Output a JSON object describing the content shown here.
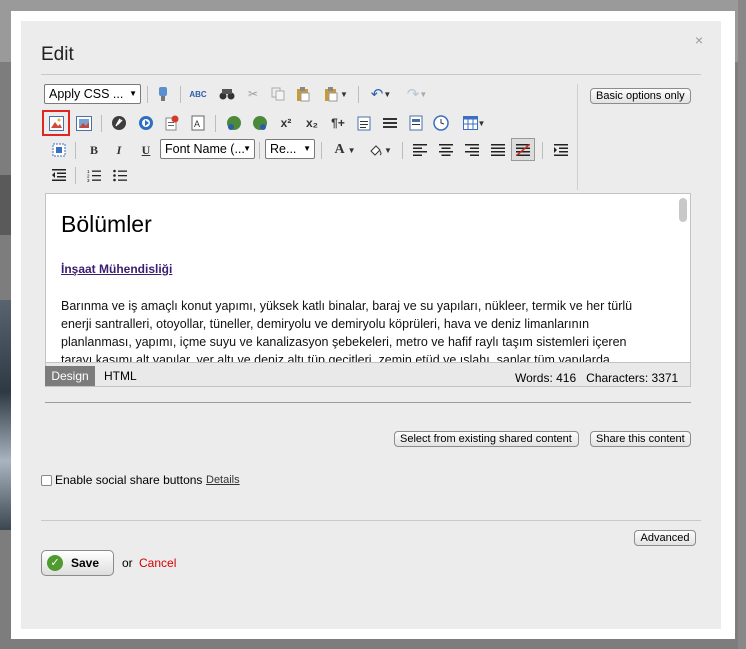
{
  "dialog": {
    "title": "Edit",
    "close": "×"
  },
  "toolbar": {
    "apply_css": "Apply CSS ...",
    "font_name": "Font Name (...",
    "font_size": "Re...",
    "basic_options": "Basic options only"
  },
  "icons": {
    "spell": "ABC",
    "superscript": "x²",
    "subscript": "x₂",
    "bold": "B",
    "italic": "I",
    "underline": "U",
    "font_color": "A",
    "paragraph": "¶+"
  },
  "editor": {
    "heading": "Bölümler",
    "link": "İnşaat Mühendisliği",
    "paragraph": "Barınma ve iş amaçlı konut yapımı, yüksek katlı binalar, baraj ve su yapıları, nükleer, termik ve her türlü enerji santralleri, otoyollar, tüneller, demiryolu ve demiryolu köprüleri, hava ve deniz limanlarının planlanması, yapımı, içme suyu ve kanalizasyon şebekeleri, metro ve hafif raylı taşım sistemleri içeren tarayı kasımı alt yapılar, yer altı ve deniz altı tüp geçitleri, zemin etüd ve ıslahı, sanlar tüm yapılarda"
  },
  "status": {
    "tab_design": "Design",
    "tab_html": "HTML",
    "words": "Words: 416",
    "characters": "Characters: 3371"
  },
  "shared": {
    "select_existing": "Select from existing shared content",
    "share": "Share this content"
  },
  "social": {
    "label": "Enable social share buttons",
    "details": "Details",
    "checked": false
  },
  "advanced": "Advanced",
  "actions": {
    "save": "Save",
    "or": "or",
    "cancel": "Cancel"
  },
  "colors": {
    "cancel": "#d40000",
    "highlight": "#e32521",
    "link": "#3a1d6e"
  }
}
